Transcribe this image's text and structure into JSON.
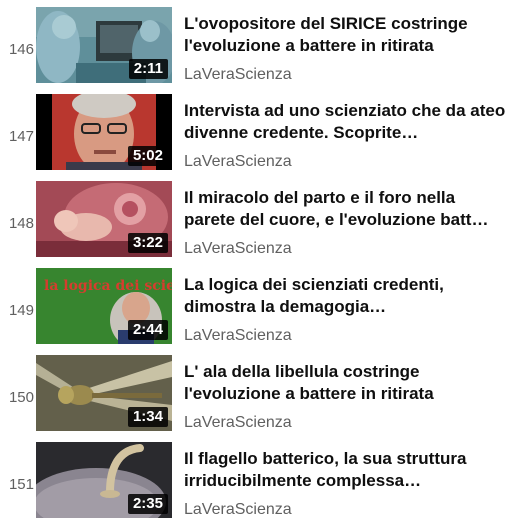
{
  "playlist": {
    "items": [
      {
        "index": "146",
        "title": "L'ovopositore del SIRICE costringe l'evoluzione a battere in ritirata",
        "channel": "LaVeraScienza",
        "duration": "2:11",
        "thumb_icon": "surgery-room-thumbnail"
      },
      {
        "index": "147",
        "title": "Intervista ad uno scienziato che da ateo divenne credente. Scoprite…",
        "channel": "LaVeraScienza",
        "duration": "5:02",
        "thumb_icon": "scientist-portrait-thumbnail"
      },
      {
        "index": "148",
        "title": "Il miracolo del parto e il foro nella parete del cuore, e l'evoluzione batt…",
        "channel": "LaVeraScienza",
        "duration": "3:22",
        "thumb_icon": "fetus-thumbnail"
      },
      {
        "index": "149",
        "title": "La logica dei scienziati credenti, dimostra la demagogia…",
        "channel": "LaVeraScienza",
        "duration": "2:44",
        "thumb_icon": "la-logica-title-card-thumbnail",
        "thumb_text": "la logica dei scienziati"
      },
      {
        "index": "150",
        "title": "L' ala della libellula costringe l'evoluzione a battere in ritirata",
        "channel": "LaVeraScienza",
        "duration": "1:34",
        "thumb_icon": "dragonfly-thumbnail"
      },
      {
        "index": "151",
        "title": "Il flagello batterico, la sua struttura irriducibilmente complessa…",
        "channel": "LaVeraScienza",
        "duration": "2:35",
        "thumb_icon": "bacterial-flagellum-thumbnail"
      }
    ]
  }
}
